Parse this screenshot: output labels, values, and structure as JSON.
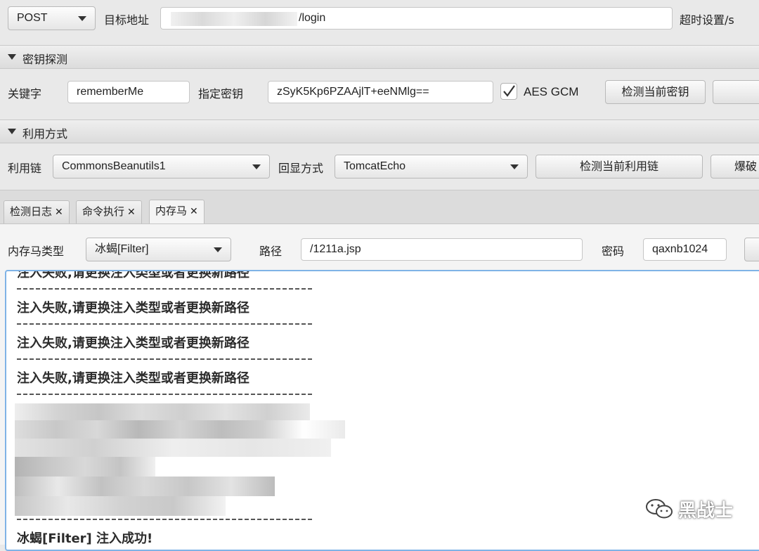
{
  "top": {
    "method": "POST",
    "target_label": "目标地址",
    "target_url_suffix": "/login",
    "timeout_label": "超时设置/s"
  },
  "key_section": {
    "title": "密钥探测",
    "keyword_label": "关键字",
    "keyword_value": "rememberMe",
    "key_label": "指定密钥",
    "key_value": "zSyK5Kp6PZAAjlT+eeNMlg==",
    "aes_gcm_label": "AES GCM",
    "aes_gcm_checked": true,
    "detect_key_button": "检测当前密钥"
  },
  "exploit_section": {
    "title": "利用方式",
    "chain_label": "利用链",
    "chain_value": "CommonsBeanutils1",
    "echo_label": "回显方式",
    "echo_value": "TomcatEcho",
    "detect_chain_button": "检测当前利用链",
    "brute_button": "爆破"
  },
  "tabs": [
    {
      "label": "检测日志",
      "close": "✕"
    },
    {
      "label": "命令执行",
      "close": "✕"
    },
    {
      "label": "内存马",
      "close": "✕"
    }
  ],
  "memshell": {
    "type_label": "内存马类型",
    "type_value": "冰蝎[Filter]",
    "path_label": "路径",
    "path_value": "/1211a.jsp",
    "password_label": "密码",
    "password_value": "qaxnb1024"
  },
  "output_lines": {
    "partial": "注入失败,请更换注入类型或者更换新路径",
    "fail1": "注入失败,请更换注入类型或者更换新路径",
    "fail2": "注入失败,请更换注入类型或者更换新路径",
    "fail3": "注入失败,请更换注入类型或者更换新路径",
    "success": "冰蝎[Filter]  注入成功!"
  },
  "watermark": "黑战士"
}
